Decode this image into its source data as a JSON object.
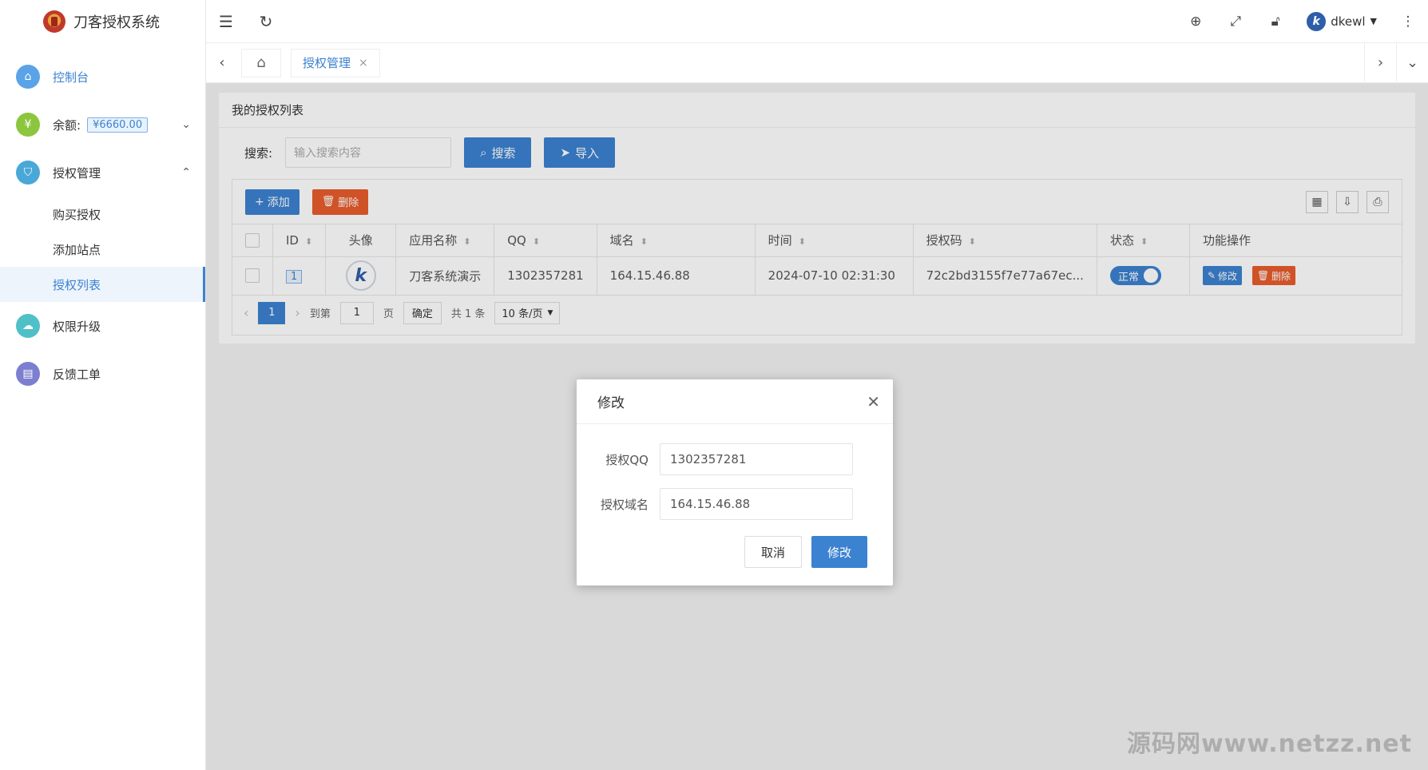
{
  "brand": {
    "title": "刀客授权系统"
  },
  "sidebar": {
    "dashboard": "控制台",
    "balance_label": "余额:",
    "balance_value": "¥6660.00",
    "auth_mgmt": "授权管理",
    "sub": {
      "buy": "购买授权",
      "add_site": "添加站点",
      "list": "授权列表"
    },
    "upgrade": "权限升级",
    "feedback": "反馈工单"
  },
  "header": {
    "user": "dkewl"
  },
  "tabs": {
    "active": "授权管理"
  },
  "card": {
    "title": "我的授权列表",
    "search_label": "搜索:",
    "search_placeholder": "输入搜索内容",
    "search_btn": "搜索",
    "import_btn": "导入",
    "add_btn": "添加",
    "delete_btn": "删除"
  },
  "table": {
    "headers": {
      "id": "ID",
      "avatar": "头像",
      "app": "应用名称",
      "qq": "QQ",
      "domain": "域名",
      "time": "时间",
      "code": "授权码",
      "status": "状态",
      "ops": "功能操作"
    },
    "rows": [
      {
        "id": "1",
        "app": "刀客系统演示",
        "qq": "1302357281",
        "domain": "164.15.46.88",
        "time": "2024-07-10 02:31:30",
        "code": "72c2bd3155f7e77a67ec...",
        "status": "正常",
        "edit": "修改",
        "del": "删除"
      }
    ]
  },
  "pager": {
    "current": "1",
    "goto": "到第",
    "page_input": "1",
    "page_word": "页",
    "confirm": "确定",
    "total": "共 1 条",
    "per_page": "10 条/页"
  },
  "modal": {
    "title": "修改",
    "qq_label": "授权QQ",
    "qq_value": "1302357281",
    "domain_label": "授权域名",
    "domain_value": "164.15.46.88",
    "cancel": "取消",
    "ok": "修改"
  },
  "watermark": "源码网www.netzz.net"
}
